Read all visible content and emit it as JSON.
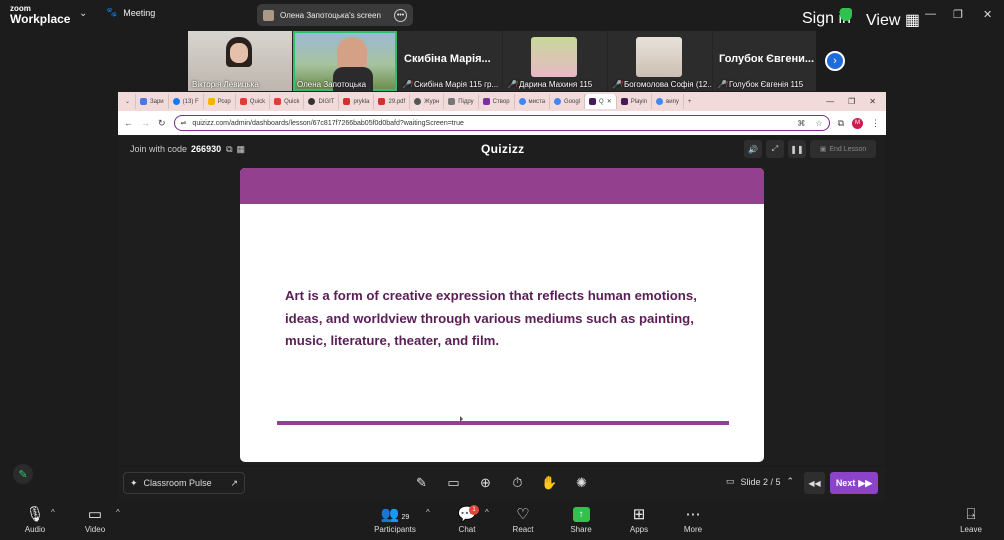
{
  "zoom_top": {
    "logo_line1": "zoom",
    "logo_line2": "Workplace",
    "meeting_label": "Meeting",
    "share_title": "Олена Запотоцька's screen",
    "signin_label": "Sign in",
    "view_label": "View"
  },
  "participants": [
    {
      "name": "Вікторія Левицька",
      "mic_off": false
    },
    {
      "name": "Олена Запотоцька",
      "mic_off": false,
      "active": true
    },
    {
      "name": "Скибіна Марія 115 гр...",
      "display": "Скибіна Марія...",
      "mic_off": true
    },
    {
      "name": "Дарина Махиня 115",
      "mic_off": true
    },
    {
      "name": "Богомолова Софія (12...",
      "mic_off": true
    },
    {
      "name": "Голубок Євгенія 115",
      "display": "Голубок Євгени...",
      "mic_off": true
    }
  ],
  "browser": {
    "tabs": [
      "Зари",
      "(13) F",
      "Розр",
      "Quick",
      "Quick",
      "DIGIT",
      "prykla",
      "29.pdf",
      "Журн",
      "Підру",
      "Створ",
      "миста",
      "Googl",
      "Q",
      "Playin",
      "випу"
    ],
    "url": "quizizz.com/admin/dashboards/lesson/67c817f7266bab05f0d0bafd?waitingScreen=true",
    "profile_initial": "M"
  },
  "quizizz": {
    "join_label": "Join with code",
    "join_code": "266930",
    "logo": "Quizizz",
    "end_lesson": "End Lesson",
    "slide_text": "Art is a form of creative expression that reflects human emotions, ideas, and worldview through various mediums such as painting, music, literature, theater, and film.",
    "classroom_pulse": "Classroom Pulse",
    "slide_counter": "Slide 2 / 5",
    "next_label": "Next",
    "accent_color": "#93418f",
    "next_color": "#8c43c9"
  },
  "zoom_bottom": {
    "audio": "Audio",
    "video": "Video",
    "participants": "Participants",
    "participants_count": "29",
    "chat": "Chat",
    "chat_badge": "1",
    "react": "React",
    "share": "Share",
    "apps": "Apps",
    "more": "More",
    "leave": "Leave"
  }
}
